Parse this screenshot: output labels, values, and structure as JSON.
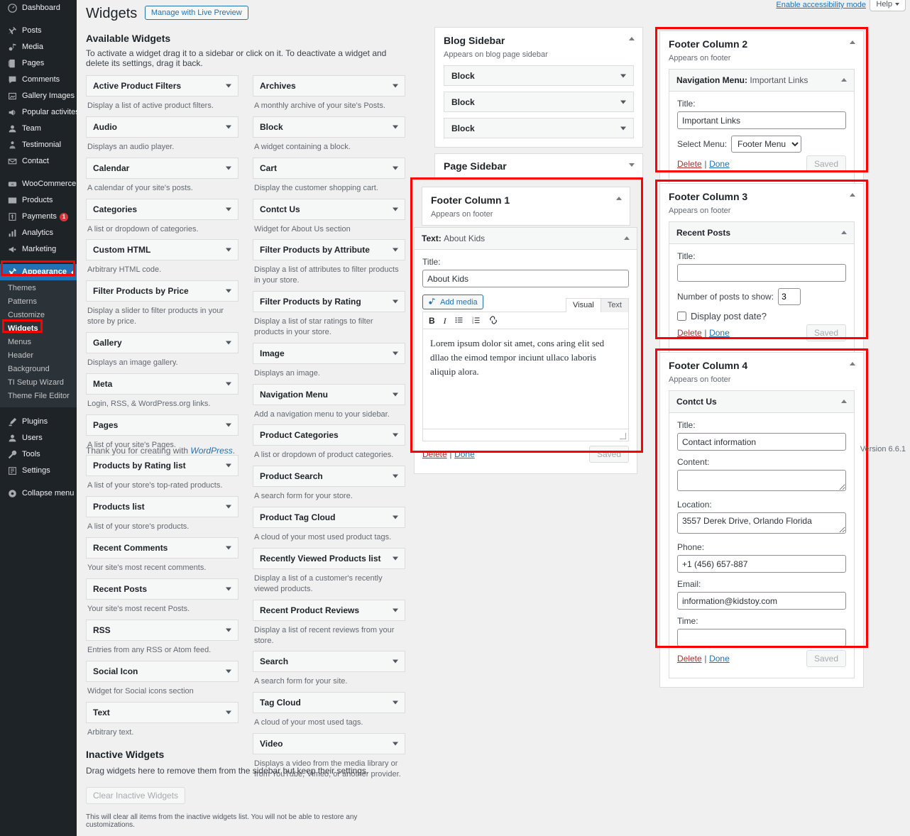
{
  "admin_menu": {
    "items": [
      {
        "label": "Dashboard",
        "icon": "dashboard-icon",
        "gap": false
      },
      {
        "label": "Posts",
        "icon": "pin-icon",
        "gap": true
      },
      {
        "label": "Media",
        "icon": "media-icon",
        "gap": false
      },
      {
        "label": "Pages",
        "icon": "pages-icon",
        "gap": false
      },
      {
        "label": "Comments",
        "icon": "comments-icon",
        "gap": false
      },
      {
        "label": "Gallery Images",
        "icon": "gallery-icon",
        "gap": false
      },
      {
        "label": "Popular activites",
        "icon": "megaphone-icon",
        "gap": false
      },
      {
        "label": "Team",
        "icon": "user-icon",
        "gap": false
      },
      {
        "label": "Testimonial",
        "icon": "testimonial-icon",
        "gap": false
      },
      {
        "label": "Contact",
        "icon": "envelope-icon",
        "gap": false
      },
      {
        "label": "WooCommerce",
        "icon": "woocommerce-icon",
        "gap": true
      },
      {
        "label": "Products",
        "icon": "products-icon",
        "gap": false
      },
      {
        "label": "Payments",
        "icon": "payments-icon",
        "gap": false,
        "badge": "1"
      },
      {
        "label": "Analytics",
        "icon": "analytics-icon",
        "gap": false
      },
      {
        "label": "Marketing",
        "icon": "marketing-icon",
        "gap": false
      }
    ],
    "appearance": {
      "label": "Appearance",
      "icon": "appearance-icon"
    },
    "appearance_sub": [
      {
        "label": "Themes",
        "current": false
      },
      {
        "label": "Patterns",
        "current": false
      },
      {
        "label": "Customize",
        "current": false
      },
      {
        "label": "Widgets",
        "current": true
      },
      {
        "label": "Menus",
        "current": false
      },
      {
        "label": "Header",
        "current": false
      },
      {
        "label": "Background",
        "current": false
      },
      {
        "label": "TI Setup Wizard",
        "current": false
      },
      {
        "label": "Theme File Editor",
        "current": false
      }
    ],
    "bottom_items": [
      {
        "label": "Plugins",
        "icon": "plugins-icon",
        "gap": true
      },
      {
        "label": "Users",
        "icon": "users-icon",
        "gap": false
      },
      {
        "label": "Tools",
        "icon": "tools-icon",
        "gap": false
      },
      {
        "label": "Settings",
        "icon": "settings-icon",
        "gap": false
      },
      {
        "label": "Collapse menu",
        "icon": "collapse-icon",
        "gap": true
      }
    ]
  },
  "topbar": {
    "accessibility_link": "Enable accessibility mode",
    "help_label": "Help"
  },
  "header": {
    "title": "Widgets",
    "live_preview_button": "Manage with Live Preview"
  },
  "available": {
    "section_title": "Available Widgets",
    "section_desc": "To activate a widget drag it to a sidebar or click on it. To deactivate a widget and delete its settings, drag it back.",
    "left_column": [
      {
        "name": "Active Product Filters",
        "desc": "Display a list of active product filters."
      },
      {
        "name": "Audio",
        "desc": "Displays an audio player."
      },
      {
        "name": "Calendar",
        "desc": "A calendar of your site's posts."
      },
      {
        "name": "Categories",
        "desc": "A list or dropdown of categories."
      },
      {
        "name": "Custom HTML",
        "desc": "Arbitrary HTML code."
      },
      {
        "name": "Filter Products by Price",
        "desc": "Display a slider to filter products in your store by price."
      },
      {
        "name": "Gallery",
        "desc": "Displays an image gallery."
      },
      {
        "name": "Meta",
        "desc": "Login, RSS, & WordPress.org links."
      },
      {
        "name": "Pages",
        "desc": "A list of your site's Pages."
      },
      {
        "name": "Products by Rating list",
        "desc": "A list of your store's top-rated products."
      },
      {
        "name": "Products list",
        "desc": "A list of your store's products."
      },
      {
        "name": "Recent Comments",
        "desc": "Your site's most recent comments."
      },
      {
        "name": "Recent Posts",
        "desc": "Your site's most recent Posts."
      },
      {
        "name": "RSS",
        "desc": "Entries from any RSS or Atom feed."
      },
      {
        "name": "Social Icon",
        "desc": "Widget for Social icons section"
      },
      {
        "name": "Text",
        "desc": "Arbitrary text."
      }
    ],
    "right_column": [
      {
        "name": "Archives",
        "desc": "A monthly archive of your site's Posts."
      },
      {
        "name": "Block",
        "desc": "A widget containing a block."
      },
      {
        "name": "Cart",
        "desc": "Display the customer shopping cart."
      },
      {
        "name": "Contct Us",
        "desc": "Widget for About Us section"
      },
      {
        "name": "Filter Products by Attribute",
        "desc": "Display a list of attributes to filter products in your store."
      },
      {
        "name": "Filter Products by Rating",
        "desc": "Display a list of star ratings to filter products in your store."
      },
      {
        "name": "Image",
        "desc": "Displays an image."
      },
      {
        "name": "Navigation Menu",
        "desc": "Add a navigation menu to your sidebar."
      },
      {
        "name": "Product Categories",
        "desc": "A list or dropdown of product categories."
      },
      {
        "name": "Product Search",
        "desc": "A search form for your store."
      },
      {
        "name": "Product Tag Cloud",
        "desc": "A cloud of your most used product tags."
      },
      {
        "name": "Recently Viewed Products list",
        "desc": "Display a list of a customer's recently viewed products."
      },
      {
        "name": "Recent Product Reviews",
        "desc": "Display a list of recent reviews from your store."
      },
      {
        "name": "Search",
        "desc": "A search form for your site."
      },
      {
        "name": "Tag Cloud",
        "desc": "A cloud of your most used tags."
      },
      {
        "name": "Video",
        "desc": "Displays a video from the media library or from YouTube, Vimeo, or another provider."
      }
    ],
    "thanks_prefix": "Thank you for creating with ",
    "thanks_link": "WordPress",
    "thanks_suffix": "."
  },
  "inactive": {
    "title": "Inactive Widgets",
    "desc": "Drag widgets here to remove them from the sidebar but keep their settings.",
    "clear_button": "Clear Inactive Widgets",
    "note": "This will clear all items from the inactive widgets list. You will not be able to restore any customizations."
  },
  "blog_sidebar": {
    "title": "Blog Sidebar",
    "desc": "Appears on blog page sidebar",
    "blocks": [
      {
        "name": "Block"
      },
      {
        "name": "Block"
      },
      {
        "name": "Block"
      }
    ]
  },
  "page_sidebar": {
    "title": "Page Sidebar"
  },
  "footer_col1": {
    "title": "Footer Column 1",
    "desc": "Appears on footer",
    "widget": {
      "type_label": "Text:",
      "instance_label": "About Kids",
      "title_label": "Title:",
      "title_value": "About Kids",
      "add_media_label": "Add media",
      "tab_visual": "Visual",
      "tab_text": "Text",
      "toolbar": [
        "bold",
        "italic",
        "bullet-list",
        "numbered-list",
        "link"
      ],
      "content": "Lorem ipsum dolor sit amet, cons aring elit sed dllao the eimod tempor inciunt ullaco laboris aliquip alora.",
      "delete_label": "Delete",
      "done_label": "Done",
      "saved_label": "Saved"
    }
  },
  "footer_col2": {
    "title": "Footer Column 2",
    "desc": "Appears on footer",
    "widget": {
      "type_label": "Navigation Menu:",
      "instance_label": "Important Links",
      "title_label": "Title:",
      "title_value": "Important Links",
      "select_menu_label": "Select Menu:",
      "select_menu_value": "Footer Menu",
      "select_menu_options": [
        "Footer Menu"
      ],
      "delete_label": "Delete",
      "done_label": "Done",
      "saved_label": "Saved"
    }
  },
  "footer_col3": {
    "title": "Footer Column 3",
    "desc": "Appears on footer",
    "widget": {
      "type_label": "Recent Posts",
      "title_label": "Title:",
      "title_value": "",
      "num_posts_label": "Number of posts to show:",
      "num_posts_value": "3",
      "display_date_label": "Display post date?",
      "display_date_checked": false,
      "delete_label": "Delete",
      "done_label": "Done",
      "saved_label": "Saved"
    }
  },
  "footer_col4": {
    "title": "Footer Column 4",
    "desc": "Appears on footer",
    "widget": {
      "type_label": "Contct Us",
      "title_label": "Title:",
      "title_value": "Contact information",
      "content_label": "Content:",
      "content_value": "",
      "location_label": "Location:",
      "location_value": "3557 Derek Drive, Orlando Florida",
      "phone_label": "Phone:",
      "phone_value": "+1 (456) 657-887",
      "email_label": "Email:",
      "email_value": "information@kidstoy.com",
      "time_label": "Time:",
      "time_value": "",
      "delete_label": "Delete",
      "done_label": "Done",
      "saved_label": "Saved"
    }
  },
  "footer": {
    "version": "Version 6.6.1"
  },
  "colors": {
    "highlight": "#ff0000",
    "accent": "#2271b1",
    "menu_bg": "#1d2327",
    "danger": "#b32d2e"
  }
}
